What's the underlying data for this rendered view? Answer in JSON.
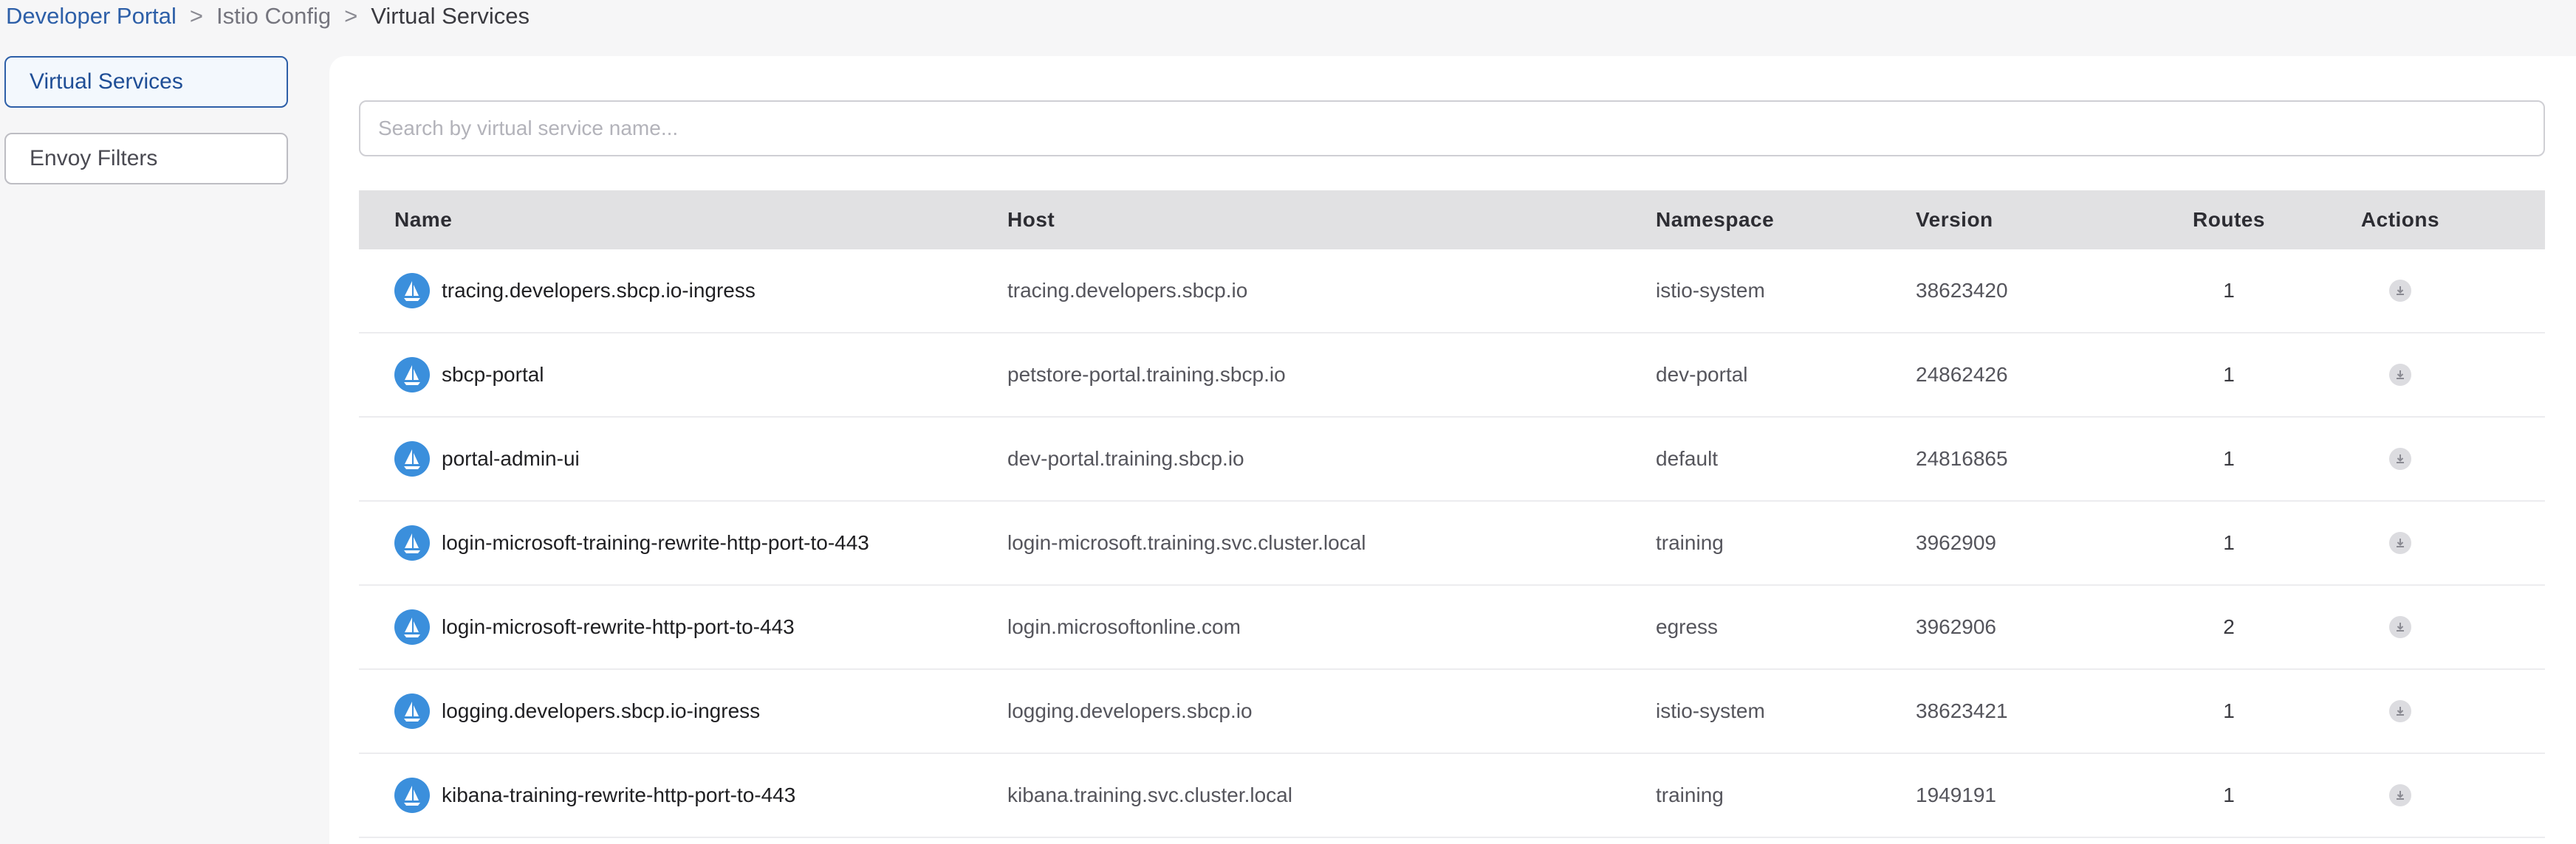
{
  "breadcrumb": {
    "items": [
      "Developer Portal",
      "Istio Config",
      "Virtual Services"
    ],
    "separator": ">"
  },
  "sidebar": {
    "items": [
      {
        "label": "Virtual Services",
        "active": true
      },
      {
        "label": "Envoy Filters",
        "active": false
      }
    ]
  },
  "search": {
    "placeholder": "Search by virtual service name..."
  },
  "table": {
    "columns": [
      "Name",
      "Host",
      "Namespace",
      "Version",
      "Routes",
      "Actions"
    ],
    "rows": [
      {
        "name": "tracing.developers.sbcp.io-ingress",
        "host": "tracing.developers.sbcp.io",
        "namespace": "istio-system",
        "version": "38623420",
        "routes": "1",
        "action_icon": "download-icon"
      },
      {
        "name": "sbcp-portal",
        "host": "petstore-portal.training.sbcp.io",
        "namespace": "dev-portal",
        "version": "24862426",
        "routes": "1",
        "action_icon": "download-icon"
      },
      {
        "name": "portal-admin-ui",
        "host": "dev-portal.training.sbcp.io",
        "namespace": "default",
        "version": "24816865",
        "routes": "1",
        "action_icon": "download-icon"
      },
      {
        "name": "login-microsoft-training-rewrite-http-port-to-443",
        "host": "login-microsoft.training.svc.cluster.local",
        "namespace": "training",
        "version": "3962909",
        "routes": "1",
        "action_icon": "download-icon"
      },
      {
        "name": "login-microsoft-rewrite-http-port-to-443",
        "host": "login.microsoftonline.com",
        "namespace": "egress",
        "version": "3962906",
        "routes": "2",
        "action_icon": "download-icon"
      },
      {
        "name": "logging.developers.sbcp.io-ingress",
        "host": "logging.developers.sbcp.io",
        "namespace": "istio-system",
        "version": "38623421",
        "routes": "1",
        "action_icon": "download-icon"
      },
      {
        "name": "kibana-training-rewrite-http-port-to-443",
        "host": "kibana.training.svc.cluster.local",
        "namespace": "training",
        "version": "1949191",
        "routes": "1",
        "action_icon": "download-icon"
      }
    ]
  },
  "icons": {
    "row_icon": "sailboat-icon",
    "action_icon": "download-icon"
  },
  "colors": {
    "accent": "#2d5fa8",
    "row_icon_bg": "#3b8fdc",
    "header_bg": "#e1e1e3"
  }
}
